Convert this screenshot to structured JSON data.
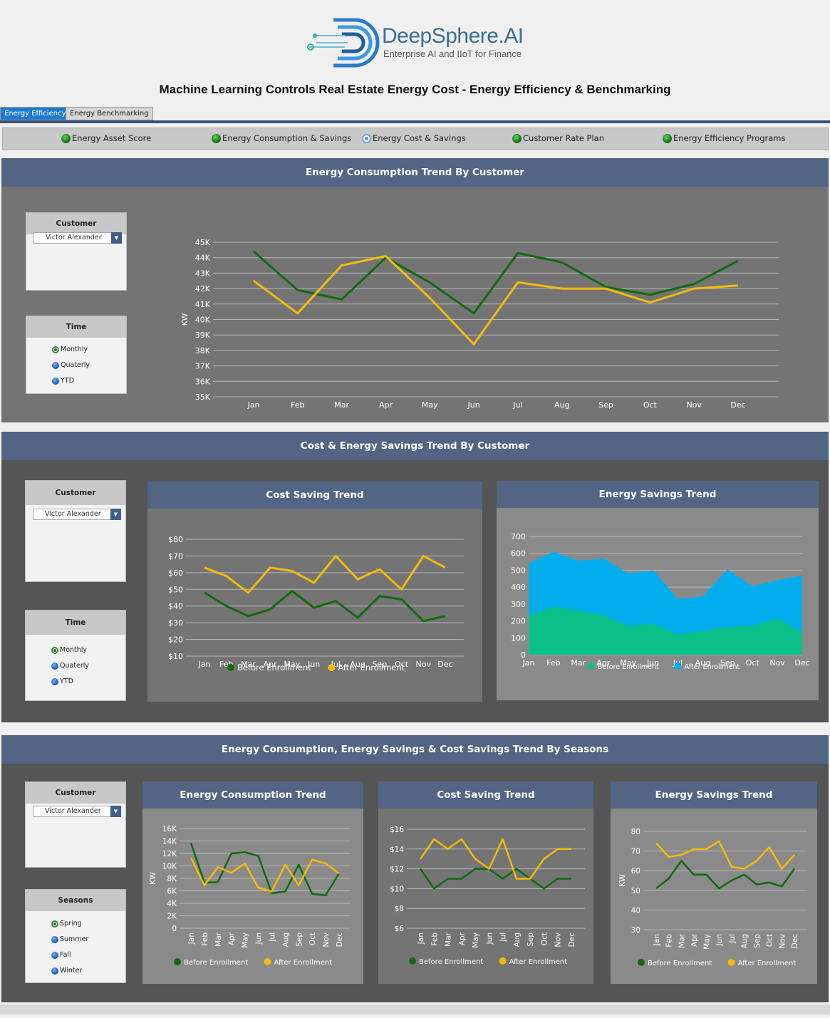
{
  "logo": {
    "brand": "DeepSphere.AI",
    "tagline": "Enterprise AI and IIoT for Finance"
  },
  "title": "Machine Learning Controls Real Estate Energy Cost - Energy Efficiency & Benchmarking",
  "tabs": [
    {
      "label": "Energy Efficiency",
      "active": true
    },
    {
      "label": "Energy Benchmarking",
      "active": false
    }
  ],
  "nav": [
    {
      "label": "Energy Asset Score",
      "icon": "green-dot-icon"
    },
    {
      "label": "Energy Consumption & Savings",
      "icon": "green-dot-icon"
    },
    {
      "label": "Energy Cost & Savings",
      "icon": "radio-selected-icon"
    },
    {
      "label": "Customer Rate Plan",
      "icon": "green-dot-icon"
    },
    {
      "label": "Energy Efficiency Programs",
      "icon": "green-dot-icon"
    }
  ],
  "colors": {
    "before": "#0e6b0e",
    "after": "#f5bb0a",
    "header": "#536585",
    "teal": "#0cc08a",
    "sky": "#03aeef"
  },
  "sections": {
    "s1": {
      "title": "Energy Consumption Trend By Customer"
    },
    "s2": {
      "title": "Cost & Energy Savings Trend By Customer"
    },
    "s3": {
      "title": "Energy Consumption, Energy Savings & Cost Savings Trend By Seasons"
    }
  },
  "filters": {
    "customer_label": "Customer",
    "customer_value": "Victor Alexander",
    "time_label": "Time",
    "time_options": [
      "Monthly",
      "Quaterly",
      "YTD"
    ],
    "seasons_label": "Seasons",
    "season_options": [
      "Spring",
      "Summer",
      "Fall",
      "Winter"
    ]
  },
  "chart_data": [
    {
      "id": "consumption_trend",
      "type": "line",
      "ylabel": "KW",
      "ylim": [
        35000,
        45000
      ],
      "yticks": [
        "35K",
        "36K",
        "37K",
        "38K",
        "39K",
        "40K",
        "41K",
        "42K",
        "43K",
        "44K",
        "45K"
      ],
      "categories": [
        "Jan",
        "Feb",
        "Mar",
        "Apr",
        "May",
        "Jun",
        "Jul",
        "Aug",
        "Sep",
        "Oct",
        "Nov",
        "Dec"
      ],
      "series": [
        {
          "name": "Before Enrollment",
          "values": [
            44400,
            41900,
            41300,
            44000,
            42400,
            40400,
            44300,
            43700,
            42100,
            41600,
            42300,
            43800
          ]
        },
        {
          "name": "After Enrollment",
          "values": [
            42500,
            40400,
            43500,
            44100,
            41400,
            38400,
            42400,
            42000,
            42000,
            41100,
            42000,
            42200
          ]
        }
      ]
    },
    {
      "id": "cost_saving_trend",
      "type": "line",
      "title": "Cost Saving Trend",
      "ylim": [
        10,
        80
      ],
      "yticks": [
        "$10",
        "$20",
        "$30",
        "$40",
        "$50",
        "$60",
        "$70",
        "$80"
      ],
      "categories": [
        "Jan",
        "Feb",
        "Mar",
        "Apr",
        "May",
        "Jun",
        "Jul",
        "Aug",
        "Sep",
        "Oct",
        "Nov",
        "Dec"
      ],
      "series": [
        {
          "name": "Before Enrollment",
          "values": [
            48,
            40,
            34,
            38,
            49,
            39,
            43,
            33,
            46,
            44,
            31,
            34
          ]
        },
        {
          "name": "After Enrollment",
          "values": [
            63,
            58,
            48,
            63,
            61,
            54,
            70,
            56,
            62,
            50,
            70,
            63
          ]
        }
      ]
    },
    {
      "id": "energy_savings_trend",
      "type": "area",
      "title": "Energy Savings Trend",
      "ylim": [
        0,
        700
      ],
      "yticks": [
        "0",
        "100",
        "200",
        "300",
        "400",
        "500",
        "600",
        "700"
      ],
      "categories": [
        "Jan",
        "Feb",
        "Mar",
        "Apr",
        "May",
        "Jun",
        "Jul",
        "Aug",
        "Sep",
        "Oct",
        "Nov",
        "Dec"
      ],
      "series": [
        {
          "name": "Before Enrollment",
          "values": [
            230,
            285,
            260,
            235,
            170,
            185,
            120,
            140,
            165,
            170,
            215,
            130
          ]
        },
        {
          "name": "After Enrollment",
          "values": [
            540,
            610,
            555,
            570,
            480,
            500,
            330,
            345,
            505,
            405,
            440,
            470
          ]
        }
      ]
    },
    {
      "id": "season_consumption_trend",
      "type": "line",
      "title": "Energy Consumption Trend",
      "ylabel": "KW",
      "ylim": [
        0,
        16000
      ],
      "yticks": [
        "0",
        "2K",
        "4K",
        "6K",
        "8K",
        "10K",
        "12K",
        "14K",
        "16K"
      ],
      "categories": [
        "Jan",
        "Feb",
        "Mar",
        "Apr",
        "May",
        "Jun",
        "Jul",
        "Aug",
        "Sep",
        "Oct",
        "Nov",
        "Dec"
      ],
      "series": [
        {
          "name": "Before Enrollment",
          "values": [
            13700,
            7300,
            7400,
            12000,
            12200,
            11600,
            5600,
            5900,
            10200,
            5500,
            5300,
            8800
          ]
        },
        {
          "name": "After Enrollment",
          "values": [
            11300,
            6900,
            9800,
            8900,
            10400,
            6500,
            5900,
            10200,
            6900,
            11000,
            10400,
            8800
          ]
        }
      ]
    },
    {
      "id": "season_cost_saving_trend",
      "type": "line",
      "title": "Cost Saving Trend",
      "ylim": [
        6,
        16
      ],
      "yticks": [
        "$6",
        "$8",
        "$10",
        "$12",
        "$14",
        "$16"
      ],
      "categories": [
        "Jan",
        "Feb",
        "Mar",
        "Apr",
        "May",
        "Jun",
        "Jul",
        "Aug",
        "Sep",
        "Oct",
        "Nov",
        "Dec"
      ],
      "series": [
        {
          "name": "Before Enrollment",
          "values": [
            12,
            10,
            11,
            11,
            12,
            12,
            11,
            12,
            11,
            10,
            11,
            11
          ]
        },
        {
          "name": "After Enrollment",
          "values": [
            13,
            15,
            14,
            15,
            13,
            12,
            15,
            11,
            11,
            13,
            14,
            14
          ]
        }
      ]
    },
    {
      "id": "season_energy_savings_trend",
      "type": "line",
      "title": "Energy Savings Trend",
      "ylabel": "KW",
      "ylim": [
        30,
        80
      ],
      "yticks": [
        "30",
        "40",
        "50",
        "60",
        "70",
        "80"
      ],
      "categories": [
        "Jan",
        "Feb",
        "Mar",
        "Apr",
        "May",
        "Jun",
        "Jul",
        "Aug",
        "Sep",
        "Oct",
        "Nov",
        "Dec"
      ],
      "series": [
        {
          "name": "Before Enrollment",
          "values": [
            51,
            56,
            65,
            58,
            58,
            51,
            55,
            58,
            53,
            54,
            52,
            61
          ]
        },
        {
          "name": "After Enrollment",
          "values": [
            74,
            67,
            68,
            71,
            71,
            75,
            62,
            61,
            65,
            72,
            61,
            68
          ]
        }
      ]
    }
  ]
}
